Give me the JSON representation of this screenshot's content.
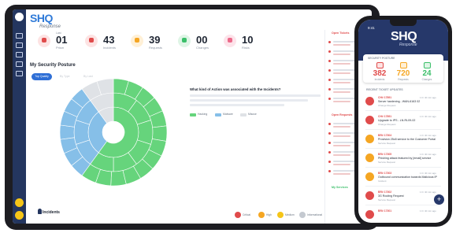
{
  "colors": {
    "navy": "#24365f",
    "accent_blue": "#2f6fd6",
    "chart_green": "#66d47c",
    "chart_blue": "#86bfe8",
    "chart_grey": "#dfe2e6",
    "red": "#e04b4b",
    "orange": "#f5a623",
    "yellow": "#f5c518",
    "green": "#3bbf6a",
    "pink": "#ec6a8a"
  },
  "tablet": {
    "logo": {
      "main": "SHQ",
      "sub": "Response"
    },
    "stats": [
      {
        "small": "Last",
        "value": "01",
        "label": "Prism",
        "color": "#fde3e3",
        "icon": "#e04b4b"
      },
      {
        "small": "",
        "value": "43",
        "label": "Incidents",
        "color": "#fde3e3",
        "icon": "#e04b4b"
      },
      {
        "small": "",
        "value": "39",
        "label": "Requests",
        "color": "#fff0d6",
        "icon": "#f5a623"
      },
      {
        "small": "",
        "value": "00",
        "label": "Changes",
        "color": "#dff5e6",
        "icon": "#3bbf6a"
      },
      {
        "small": "",
        "value": "10",
        "label": "Risks",
        "color": "#fde3ea",
        "icon": "#ec6a8a"
      }
    ],
    "section_title": "My Security Posture",
    "tabs": [
      "Top Quality",
      "By Type",
      "By Last"
    ],
    "question": "What kind of Action was associated with the Incidents?",
    "legend": [
      {
        "label": "Hacking",
        "color": "#66d47c"
      },
      {
        "label": "Malware",
        "color": "#86bfe8"
      },
      {
        "label": "Misuse",
        "color": "#dfe2e6"
      }
    ],
    "incidents_label": "Incidents",
    "severity": [
      {
        "label": "Critical",
        "color": "#e04b4b"
      },
      {
        "label": "High",
        "color": "#f5a623"
      },
      {
        "label": "Medium",
        "color": "#f5c518"
      },
      {
        "label": "Informational",
        "color": "#c4c9d0"
      }
    ],
    "right_panel": {
      "head1": "Open Tickets",
      "head2": "Open Requests",
      "head3": "My Services"
    },
    "chart_shares": {
      "green": 0.6,
      "blue": 0.3,
      "grey": 0.1
    }
  },
  "phone": {
    "time": "9:41",
    "logo_main": "SHQ",
    "logo_sub": "Response",
    "card_title": "SECURITY POSTURE",
    "stats": [
      {
        "value": "382",
        "label": "Incidents",
        "color": "#e04b4b"
      },
      {
        "value": "720",
        "label": "Requests",
        "color": "#f5a623"
      },
      {
        "value": "24",
        "label": "Changes",
        "color": "#3bbf6a"
      }
    ],
    "list_title": "RECENT TICKET UPDATES",
    "items": [
      {
        "id": "CH# 17891",
        "time": "1 hr 40 min ago",
        "title": "Server hardening - WAN-6163 02",
        "meta": "Change Request",
        "color": "#e04b4b"
      },
      {
        "id": "CH# 17891",
        "time": "1 hr 40 min ago",
        "title": "Upgrade to IPS - LN-RL09-02",
        "meta": "Change Request",
        "color": "#e04b4b"
      },
      {
        "id": "BR# 17304",
        "time": "1 hr 40 min ago",
        "title": "Provision 25x8 service to the Customer Portal",
        "meta": "Service Request",
        "color": "#f5a623"
      },
      {
        "id": "BR# 17305",
        "time": "1 hr 40 min ago",
        "title": "Phishing attack featured by [email] service",
        "meta": "Service Request",
        "color": "#f5a623"
      },
      {
        "id": "BR# 17303",
        "time": "1 hr 40 min ago",
        "title": "Outbound communication towards Malicious IP",
        "meta": "Incident",
        "color": "#f5a623"
      },
      {
        "id": "BR# 17302",
        "time": "1 hr 40 min ago",
        "title": "3G Routing Request",
        "meta": "Service Request",
        "color": "#e04b4b"
      },
      {
        "id": "BR# 17301",
        "time": "1 hr 40 min ago",
        "title": "",
        "meta": "",
        "color": "#e04b4b"
      }
    ],
    "fab": "+"
  }
}
